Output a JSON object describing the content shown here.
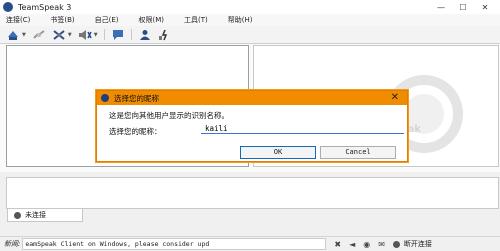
{
  "window": {
    "title": "TeamSpeak 3",
    "min": "—",
    "max": "☐",
    "close": "✕"
  },
  "menu": [
    {
      "label": "连接(C)"
    },
    {
      "label": "书签(B)"
    },
    {
      "label": "自己(E)"
    },
    {
      "label": "权限(M)"
    },
    {
      "label": "工具(T)"
    },
    {
      "label": "帮助(H)"
    }
  ],
  "watermark": {
    "text": "mSpeak"
  },
  "server_tab": {
    "label": "未连接"
  },
  "status": {
    "news_label": "新闻:",
    "news_text": "eamSpeak Client on Windows, please consider upd",
    "connection": "断开连接"
  },
  "dialog": {
    "title": "选择您的昵称",
    "close": "✕",
    "description": "这是您向其他用户显示的识别名称。",
    "label": "选择您的昵称：",
    "value": "kaili",
    "ok": "OK",
    "cancel": "Cancel"
  }
}
